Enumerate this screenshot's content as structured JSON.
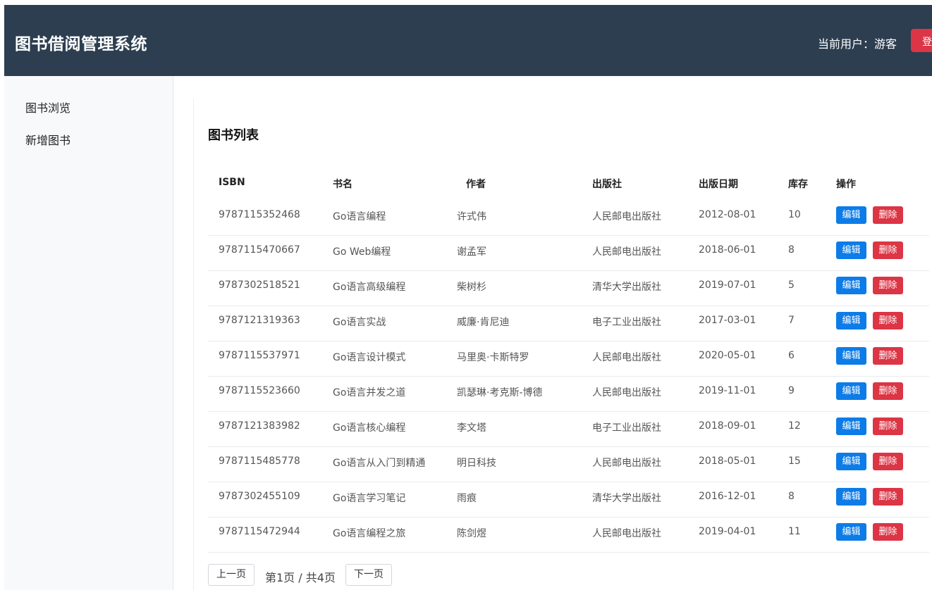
{
  "header": {
    "title": "图书借阅管理系统",
    "current_user": "当前用户：游客",
    "login_label": "登录"
  },
  "sidebar": {
    "items": [
      {
        "label": "图书浏览"
      },
      {
        "label": "新增图书"
      }
    ]
  },
  "main": {
    "title": "图书列表",
    "columns": [
      "ISBN",
      "书名",
      "作者",
      "出版社",
      "出版日期",
      "库存",
      "操作"
    ],
    "rows": [
      {
        "isbn": "9787115352468",
        "title": "Go语言编程",
        "author": "许式伟",
        "publisher": "人民邮电出版社",
        "date": "2012-08-01",
        "stock": "10"
      },
      {
        "isbn": "9787115470667",
        "title": "Go Web编程",
        "author": "谢孟军",
        "publisher": "人民邮电出版社",
        "date": "2018-06-01",
        "stock": "8"
      },
      {
        "isbn": "9787302518521",
        "title": "Go语言高级编程",
        "author": "柴树杉",
        "publisher": "清华大学出版社",
        "date": "2019-07-01",
        "stock": "5"
      },
      {
        "isbn": "9787121319363",
        "title": "Go语言实战",
        "author": "威廉·肯尼迪",
        "publisher": "电子工业出版社",
        "date": "2017-03-01",
        "stock": "7"
      },
      {
        "isbn": "9787115537971",
        "title": "Go语言设计模式",
        "author": "马里奥·卡斯特罗",
        "publisher": "人民邮电出版社",
        "date": "2020-05-01",
        "stock": "6"
      },
      {
        "isbn": "9787115523660",
        "title": "Go语言并发之道",
        "author": "凯瑟琳·考克斯-博德",
        "publisher": "人民邮电出版社",
        "date": "2019-11-01",
        "stock": "9"
      },
      {
        "isbn": "9787121383982",
        "title": "Go语言核心编程",
        "author": "李文塔",
        "publisher": "电子工业出版社",
        "date": "2018-09-01",
        "stock": "12"
      },
      {
        "isbn": "9787115485778",
        "title": "Go语言从入门到精通",
        "author": "明日科技",
        "publisher": "人民邮电出版社",
        "date": "2018-05-01",
        "stock": "15"
      },
      {
        "isbn": "9787302455109",
        "title": "Go语言学习笔记",
        "author": "雨痕",
        "publisher": "清华大学出版社",
        "date": "2016-12-01",
        "stock": "8"
      },
      {
        "isbn": "9787115472944",
        "title": "Go语言编程之旅",
        "author": "陈剑煜",
        "publisher": "人民邮电出版社",
        "date": "2019-04-01",
        "stock": "11"
      }
    ],
    "edit_label": "编辑",
    "delete_label": "删除"
  },
  "pagination": {
    "prev_label": "上一页",
    "info": "第1页 / 共4页",
    "next_label": "下一页"
  },
  "colors": {
    "header_bg": "#2d3e50",
    "edit_button": "#0d7ce8",
    "delete_button": "#dc3545"
  }
}
